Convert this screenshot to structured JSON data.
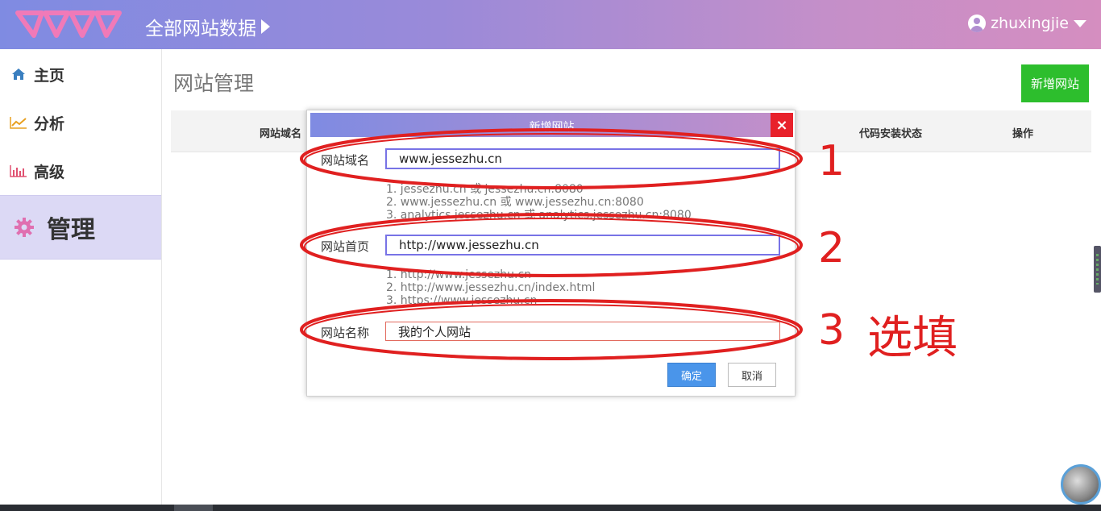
{
  "header": {
    "title": "全部网站数据",
    "username": "zhuxingjie"
  },
  "sidebar": {
    "items": [
      {
        "label": "主页",
        "icon": "home-icon"
      },
      {
        "label": "分析",
        "icon": "line-chart-icon"
      },
      {
        "label": "高级",
        "icon": "bar-chart-icon"
      },
      {
        "label": "管理",
        "icon": "gear-icon",
        "active": true
      }
    ]
  },
  "main": {
    "page_title": "网站管理",
    "add_button": "新增网站",
    "table_headers": [
      "网站域名",
      "代码安装状态",
      "操作"
    ]
  },
  "modal": {
    "title": "新增网站",
    "close": "×",
    "fields": [
      {
        "label": "网站域名",
        "value": "www.jessezhu.cn",
        "hints": [
          "1. jessezhu.cn 或 jessezhu.cn:8080",
          "2. www.jessezhu.cn 或 www.jessezhu.cn:8080",
          "3. analytics.jessezhu.cn 或 analytics.jessezhu.cn:8080"
        ]
      },
      {
        "label": "网站首页",
        "value": "http://www.jessezhu.cn",
        "hints": [
          "1. http://www.jessezhu.cn",
          "2. http://www.jessezhu.cn/index.html",
          "3. https://www.jessezhu.cn"
        ]
      },
      {
        "label": "网站名称",
        "value": "我的个人网站"
      }
    ],
    "confirm": "确定",
    "cancel": "取消"
  },
  "annotations": {
    "numbers": [
      "1",
      "2",
      "3"
    ],
    "optional_label": "选填",
    "color": "#e02020"
  },
  "colors": {
    "header_gradient_start": "#7f8be2",
    "header_gradient_end": "#d58ec0",
    "add_button": "#2dbe2d",
    "close_button": "#e8212b",
    "confirm_button": "#4a95ea",
    "active_sidebar": "#dcd9f5"
  }
}
